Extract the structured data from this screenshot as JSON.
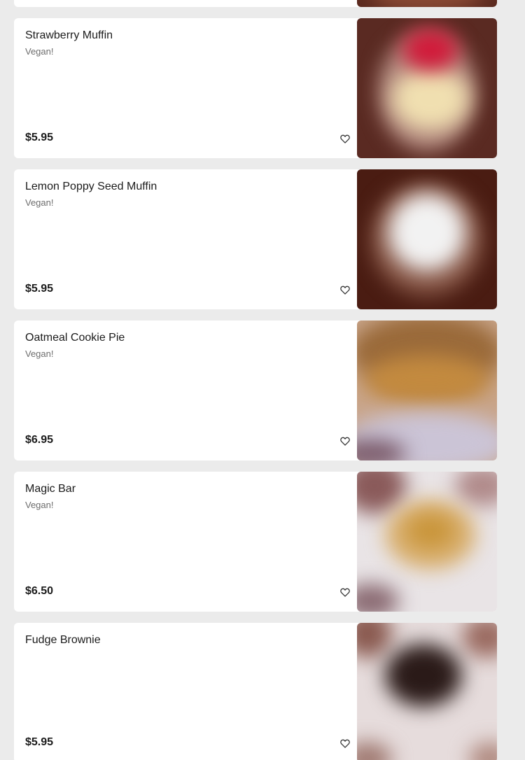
{
  "menu_items": [
    {
      "name": "Strawberry Muffin",
      "tag": "Vegan!",
      "price": "$5.95",
      "icon": "heart-outline-icon"
    },
    {
      "name": "Lemon Poppy Seed Muffin",
      "tag": "Vegan!",
      "price": "$5.95",
      "icon": "heart-outline-icon"
    },
    {
      "name": "Oatmeal Cookie Pie",
      "tag": "Vegan!",
      "price": "$6.95",
      "icon": "heart-outline-icon"
    },
    {
      "name": "Magic Bar",
      "tag": "Vegan!",
      "price": "$6.50",
      "icon": "heart-outline-icon"
    },
    {
      "name": "Fudge Brownie",
      "tag": "",
      "price": "$5.95",
      "icon": "heart-outline-icon"
    }
  ],
  "colors": {
    "background": "#ebebeb",
    "card": "#ffffff",
    "text": "#1b1b1b",
    "muted": "#6d6d6d"
  }
}
